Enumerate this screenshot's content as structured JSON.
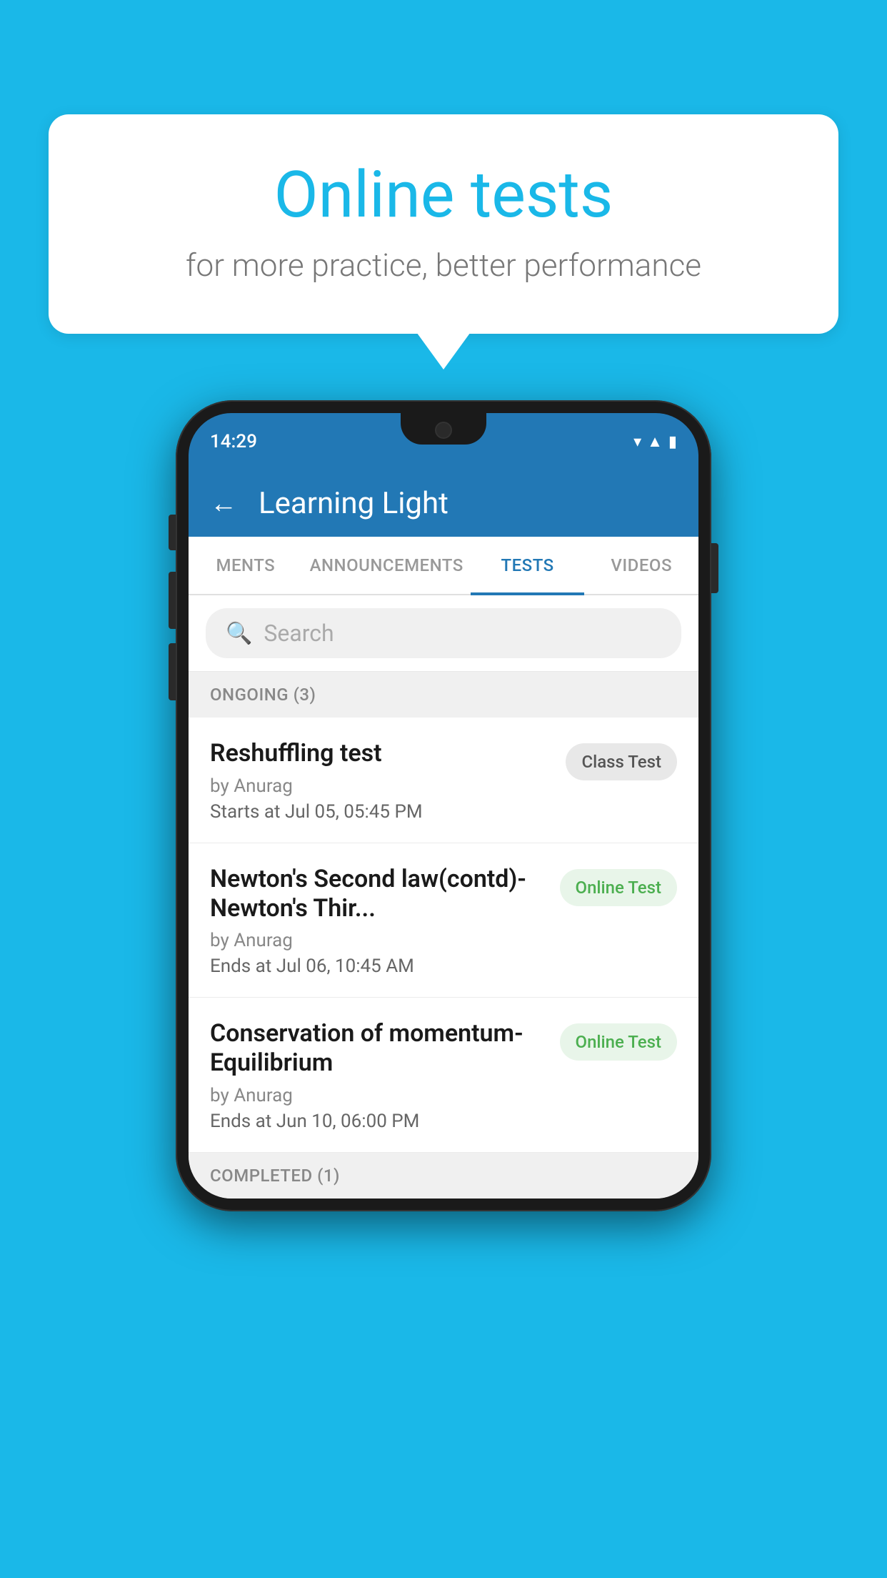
{
  "background_color": "#1ab8e8",
  "bubble": {
    "title": "Online tests",
    "subtitle": "for more practice, better performance"
  },
  "phone": {
    "status_bar": {
      "time": "14:29",
      "icons": [
        "wifi",
        "signal",
        "battery"
      ]
    },
    "app_header": {
      "title": "Learning Light",
      "back_label": "←"
    },
    "tabs": [
      {
        "label": "MENTS",
        "active": false
      },
      {
        "label": "ANNOUNCEMENTS",
        "active": false
      },
      {
        "label": "TESTS",
        "active": true
      },
      {
        "label": "VIDEOS",
        "active": false
      }
    ],
    "search": {
      "placeholder": "Search"
    },
    "ongoing_section": {
      "header": "ONGOING (3)",
      "tests": [
        {
          "name": "Reshuffling test",
          "by": "by Anurag",
          "time_label": "Starts at",
          "time": "Jul 05, 05:45 PM",
          "badge": "Class Test",
          "badge_type": "class"
        },
        {
          "name": "Newton's Second law(contd)-Newton's Thir...",
          "by": "by Anurag",
          "time_label": "Ends at",
          "time": "Jul 06, 10:45 AM",
          "badge": "Online Test",
          "badge_type": "online"
        },
        {
          "name": "Conservation of momentum-Equilibrium",
          "by": "by Anurag",
          "time_label": "Ends at",
          "time": "Jun 10, 06:00 PM",
          "badge": "Online Test",
          "badge_type": "online"
        }
      ]
    },
    "completed_section": {
      "header": "COMPLETED (1)"
    }
  }
}
